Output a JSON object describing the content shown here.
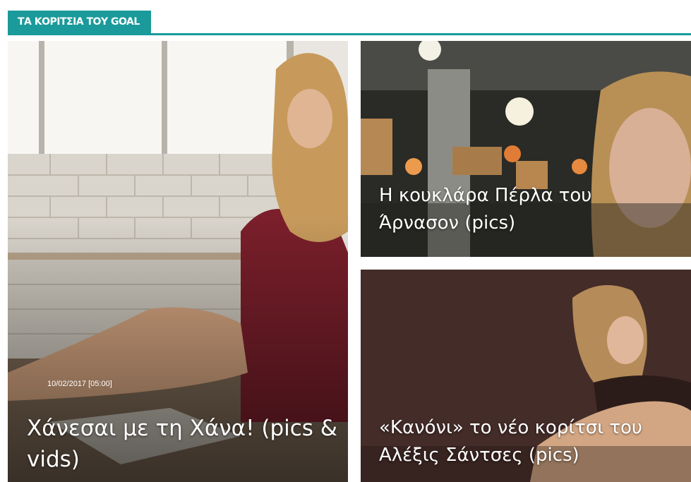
{
  "section": {
    "title": "ΤΑ ΚΟΡΙΤΣΙΑ ΤΟΥ GOAL",
    "accent_color": "#1a9a9a"
  },
  "articles": [
    {
      "date": "10/02/2017 [05:00]",
      "title": "Χάνεσαι με τη Χάνα! (pics & vids)"
    },
    {
      "title": "Η κουκλάρα Πέρλα του Άρνασον (pics)"
    },
    {
      "title": "«Κανόνι» το νέο κορίτσι του Αλέξις Σάντσες (pics)"
    }
  ]
}
